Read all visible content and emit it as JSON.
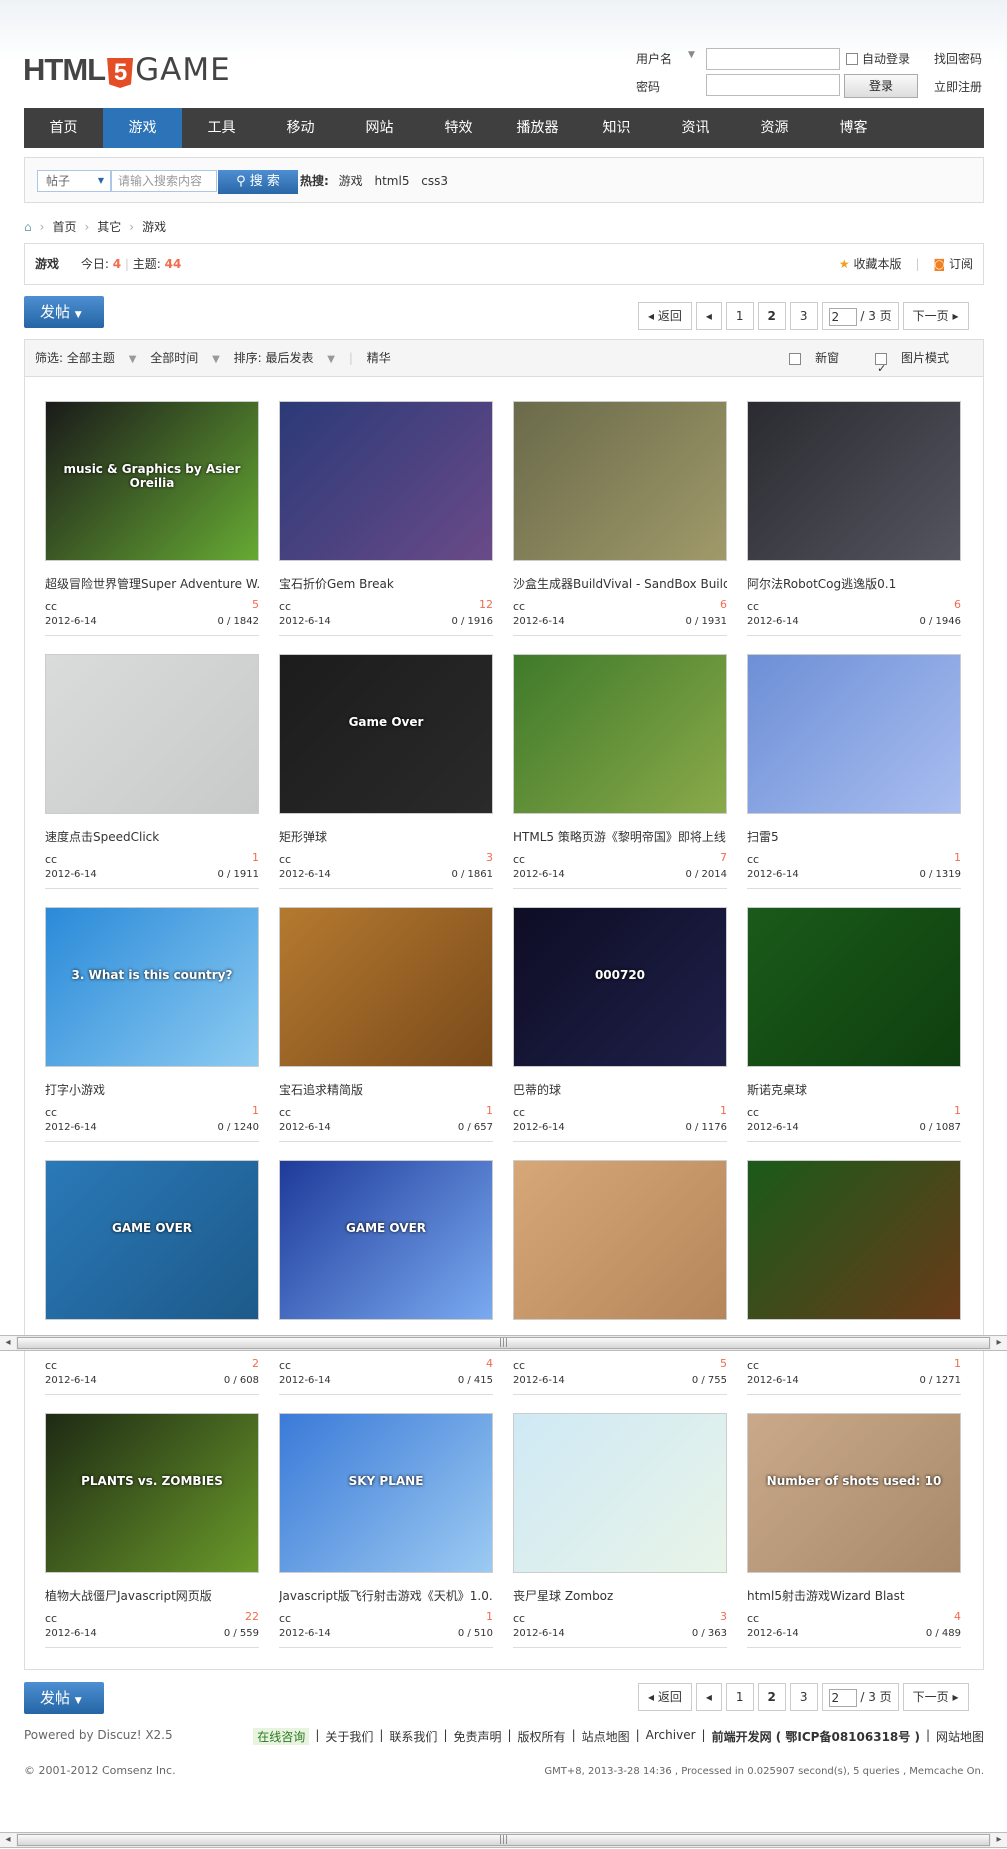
{
  "header": {
    "logo_pre": "HTML",
    "logo_five": "5",
    "logo_post": "GAME",
    "username_label": "用户名",
    "password_label": "密码",
    "auto_login": "自动登录",
    "find_password": "找回密码",
    "login_button": "登录",
    "register": "立即注册"
  },
  "nav": [
    "首页",
    "游戏",
    "工具",
    "移动",
    "网站",
    "特效",
    "播放器",
    "知识",
    "资讯",
    "资源",
    "博客"
  ],
  "search": {
    "type": "帖子",
    "placeholder": "请输入搜索内容",
    "button": "搜 索",
    "hot_label": "热搜:",
    "hot": [
      "游戏",
      "html5",
      "css3"
    ]
  },
  "breadcrumb": [
    "首页",
    "其它",
    "游戏"
  ],
  "forum": {
    "name": "游戏",
    "today_label": "今日:",
    "today": "4",
    "topics_label": "主题:",
    "topics": "44",
    "favorite": "收藏本版",
    "subscribe": "订阅"
  },
  "post_button": "发帖",
  "pager": {
    "back": "返回",
    "pages": [
      "1",
      "2",
      "3"
    ],
    "current": "2",
    "input": "2",
    "total": "/ 3 页",
    "next": "下一页"
  },
  "filter": {
    "items": [
      "筛选: 全部主题",
      "全部时间",
      "排序: 最后发表",
      "精华"
    ],
    "new_window": "新窗",
    "image_mode": "图片模式"
  },
  "cards": [
    {
      "title": "超级冒险世界管理Super Adventure W...",
      "author": "cc",
      "replies": "5",
      "date": "2012-6-14",
      "stats": "0 / 1842",
      "c1": "#1a1a1a",
      "c2": "#6a3",
      "txt": "music & Graphics by Asier Oreilia"
    },
    {
      "title": "宝石折价Gem Break",
      "author": "cc",
      "replies": "12",
      "date": "2012-6-14",
      "stats": "0 / 1916",
      "c1": "#2b3a78",
      "c2": "#6a4a88",
      "txt": ""
    },
    {
      "title": "沙盒生成器BuildVival - SandBox Builder",
      "author": "cc",
      "replies": "6",
      "date": "2012-6-14",
      "stats": "0 / 1931",
      "c1": "#6a6a4a",
      "c2": "#a09a6a",
      "txt": ""
    },
    {
      "title": "阿尔法RobotCog逃逸版0.1",
      "author": "cc",
      "replies": "6",
      "date": "2012-6-14",
      "stats": "0 / 1946",
      "c1": "#2a2a30",
      "c2": "#555560",
      "txt": ""
    },
    {
      "title": "速度点击SpeedClick",
      "author": "cc",
      "replies": "1",
      "date": "2012-6-14",
      "stats": "0 / 1911",
      "c1": "#dadcdc",
      "c2": "#c8caca",
      "txt": ""
    },
    {
      "title": "矩形弹球",
      "author": "cc",
      "replies": "3",
      "date": "2012-6-14",
      "stats": "0 / 1861",
      "c1": "#1c1c1c",
      "c2": "#2a2a2a",
      "txt": "Game Over"
    },
    {
      "title": "HTML5 策略页游《黎明帝国》即将上线",
      "author": "cc",
      "replies": "7",
      "date": "2012-6-14",
      "stats": "0 / 2014",
      "c1": "#3f7a2a",
      "c2": "#8aaa4a",
      "txt": ""
    },
    {
      "title": "扫雷5",
      "author": "cc",
      "replies": "1",
      "date": "2012-6-14",
      "stats": "0 / 1319",
      "c1": "#6d8fd6",
      "c2": "#a9bef0",
      "txt": ""
    },
    {
      "title": "打字小游戏",
      "author": "cc",
      "replies": "1",
      "date": "2012-6-14",
      "stats": "0 / 1240",
      "c1": "#2a8ad8",
      "c2": "#8ccbf2",
      "txt": "3. What is this country?"
    },
    {
      "title": "宝石追求精简版",
      "author": "cc",
      "replies": "1",
      "date": "2012-6-14",
      "stats": "0 / 657",
      "c1": "#b57a30",
      "c2": "#7a4a1a",
      "txt": ""
    },
    {
      "title": "巴蒂的球",
      "author": "cc",
      "replies": "1",
      "date": "2012-6-14",
      "stats": "0 / 1176",
      "c1": "#0d0d25",
      "c2": "#20204a",
      "txt": "000720"
    },
    {
      "title": "斯诺克桌球",
      "author": "cc",
      "replies": "1",
      "date": "2012-6-14",
      "stats": "0 / 1087",
      "c1": "#1a5a1a",
      "c2": "#0f3f0f",
      "txt": ""
    },
    {
      "title": "",
      "author": "cc",
      "replies": "2",
      "date": "2012-6-14",
      "stats": "0 / 608",
      "c1": "#2a79b8",
      "c2": "#1d5a8a",
      "txt": "GAME OVER"
    },
    {
      "title": "",
      "author": "cc",
      "replies": "4",
      "date": "2012-6-14",
      "stats": "0 / 415",
      "c1": "#1e3a9a",
      "c2": "#7aaaf0",
      "txt": "GAME OVER"
    },
    {
      "title": "",
      "author": "cc",
      "replies": "5",
      "date": "2012-6-14",
      "stats": "0 / 755",
      "c1": "#d6a878",
      "c2": "#b5865a",
      "txt": ""
    },
    {
      "title": "",
      "author": "cc",
      "replies": "1",
      "date": "2012-6-14",
      "stats": "0 / 1271",
      "c1": "#1a5a1a",
      "c2": "#6a3a1a",
      "txt": ""
    },
    {
      "title": "植物大战僵尸Javascript网页版",
      "author": "cc",
      "replies": "22",
      "date": "2012-6-14",
      "stats": "0 / 559",
      "c1": "#1e2a14",
      "c2": "#6a9a2a",
      "txt": "PLANTS vs. ZOMBIES"
    },
    {
      "title": "Javascript版飞行射击游戏《天机》1.0...",
      "author": "cc",
      "replies": "1",
      "date": "2012-6-14",
      "stats": "0 / 510",
      "c1": "#3a7ad8",
      "c2": "#9ccaf2",
      "txt": "SKY PLANE"
    },
    {
      "title": "丧尸星球 Zomboz",
      "author": "cc",
      "replies": "3",
      "date": "2012-6-14",
      "stats": "0 / 363",
      "c1": "#cfe9f5",
      "c2": "#e8f4e8",
      "txt": ""
    },
    {
      "title": "html5射击游戏Wizard Blast",
      "author": "cc",
      "replies": "4",
      "date": "2012-6-14",
      "stats": "0 / 489",
      "c1": "#c9a98a",
      "c2": "#a88a6a",
      "txt": "Number of shots used: 10"
    }
  ],
  "footer": {
    "powered": "Powered by Discuz! X2.5",
    "copyright": "© 2001-2012 Comsenz Inc.",
    "links": [
      "在线咨询",
      "关于我们",
      "联系我们",
      "免责声明",
      "版权所有",
      "站点地图",
      "Archiver",
      "前端开发网 ( 鄂ICP备08106318号 )",
      "网站地图"
    ],
    "stat": "GMT+8, 2013-3-28 14:36 , Processed in 0.025907 second(s), 5 queries , Memcache On."
  }
}
